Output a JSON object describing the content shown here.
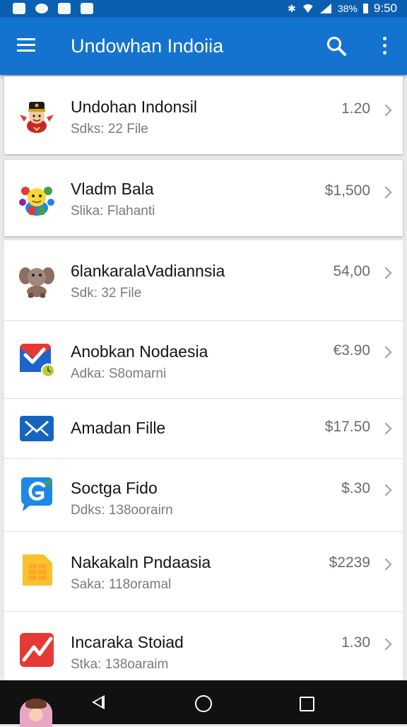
{
  "status_bar": {
    "battery": " 38%",
    "time": "9:50"
  },
  "app_bar": {
    "title": "Undowhan Indoiia"
  },
  "items": [
    {
      "title": "Undohan Indonsil",
      "subtitle": "Sdks: 22 File",
      "price": "1.20",
      "icon": "royal-mascot-icon"
    },
    {
      "title": "Vladm Bala",
      "subtitle": "Slika: Flahanti",
      "price": "$1,500",
      "icon": "colorful-creature-icon"
    },
    {
      "title": "6lankaralaVadiannsia",
      "subtitle": "Sdk: 32 File",
      "price": "54,00",
      "icon": "elephant-icon"
    },
    {
      "title": "Anobkan Nodaesia",
      "subtitle": "Adka: S8omarni",
      "price": "€3.90",
      "icon": "mail-check-icon"
    },
    {
      "title": "Amadan Fille",
      "subtitle": "",
      "price": "$17.50",
      "icon": "envelope-icon"
    },
    {
      "title": "Soctga Fido",
      "subtitle": "Ddks: 138oorairn",
      "price": "$.30",
      "icon": "g-bubble-icon"
    },
    {
      "title": "Nakakaln Pndaasia",
      "subtitle": "Saka: 118oramal",
      "price": "$2239",
      "icon": "sim-card-icon"
    },
    {
      "title": "Incaraka Stoiad",
      "subtitle": "Stka: 138oaraim",
      "price": "1.30",
      "icon": "red-tick-icon"
    }
  ]
}
